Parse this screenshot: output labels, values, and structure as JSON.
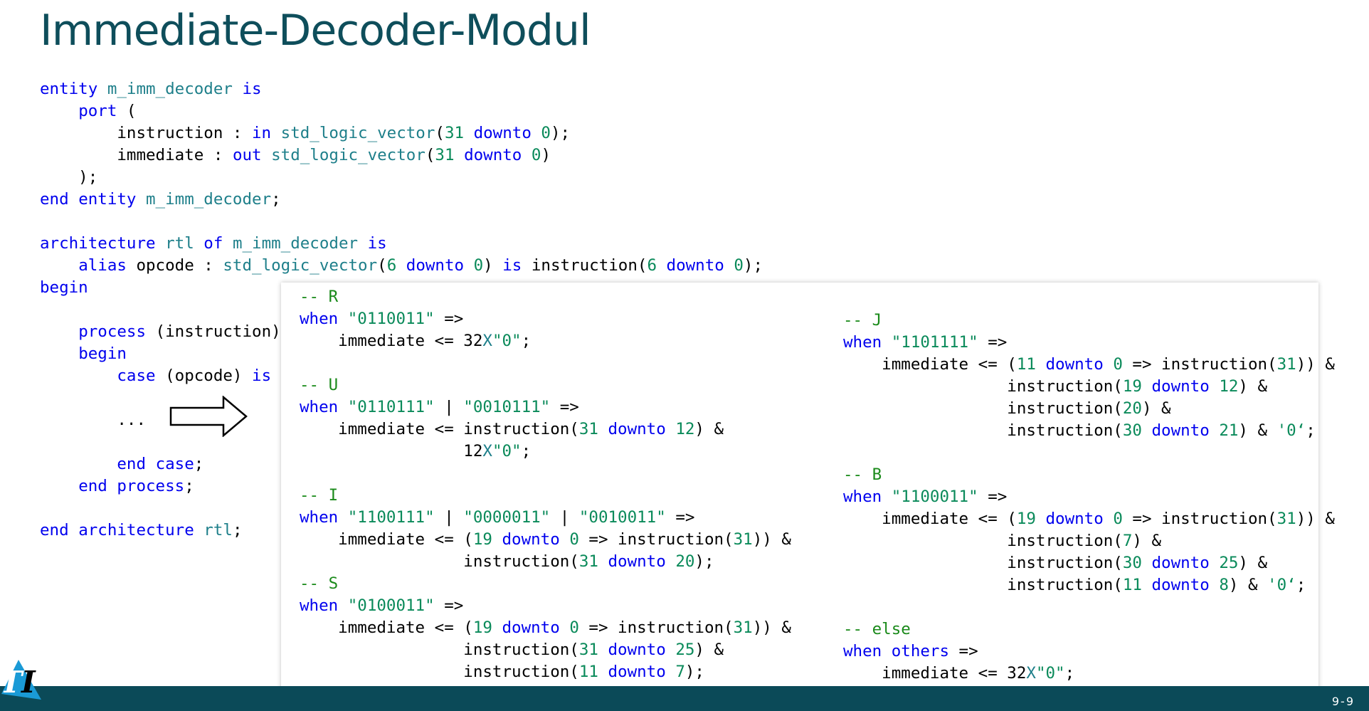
{
  "title": "Immediate-Decoder-Modul",
  "page_number": "9-9",
  "logo_text": "TI",
  "colors": {
    "accent": "#0b4a58",
    "keyword": "#0000ee",
    "type": "#1e7f8a",
    "number": "#0a8a5a",
    "comment": "#1a8a1a"
  },
  "main_code": [
    [
      [
        "kw",
        "entity"
      ],
      [
        "tx",
        " "
      ],
      [
        "ty",
        "m_imm_decoder"
      ],
      [
        "tx",
        " "
      ],
      [
        "kw",
        "is"
      ]
    ],
    [
      [
        "tx",
        "    "
      ],
      [
        "kw",
        "port"
      ],
      [
        "tx",
        " ("
      ]
    ],
    [
      [
        "tx",
        "        instruction : "
      ],
      [
        "kw",
        "in"
      ],
      [
        "tx",
        " "
      ],
      [
        "ty",
        "std_logic_vector"
      ],
      [
        "tx",
        "("
      ],
      [
        "nm",
        "31"
      ],
      [
        "tx",
        " "
      ],
      [
        "kw",
        "downto"
      ],
      [
        "tx",
        " "
      ],
      [
        "nm",
        "0"
      ],
      [
        "tx",
        ");"
      ]
    ],
    [
      [
        "tx",
        "        immediate : "
      ],
      [
        "kw",
        "out"
      ],
      [
        "tx",
        " "
      ],
      [
        "ty",
        "std_logic_vector"
      ],
      [
        "tx",
        "("
      ],
      [
        "nm",
        "31"
      ],
      [
        "tx",
        " "
      ],
      [
        "kw",
        "downto"
      ],
      [
        "tx",
        " "
      ],
      [
        "nm",
        "0"
      ],
      [
        "tx",
        ")"
      ]
    ],
    [
      [
        "tx",
        "    );"
      ]
    ],
    [
      [
        "kw",
        "end"
      ],
      [
        "tx",
        " "
      ],
      [
        "kw",
        "entity"
      ],
      [
        "tx",
        " "
      ],
      [
        "ty",
        "m_imm_decoder"
      ],
      [
        "tx",
        ";"
      ]
    ],
    [
      [
        "tx",
        ""
      ]
    ],
    [
      [
        "kw",
        "architecture"
      ],
      [
        "tx",
        " "
      ],
      [
        "ty",
        "rtl"
      ],
      [
        "tx",
        " "
      ],
      [
        "kw",
        "of"
      ],
      [
        "tx",
        " "
      ],
      [
        "ty",
        "m_imm_decoder"
      ],
      [
        "tx",
        " "
      ],
      [
        "kw",
        "is"
      ]
    ],
    [
      [
        "tx",
        "    "
      ],
      [
        "kw",
        "alias"
      ],
      [
        "tx",
        " opcode : "
      ],
      [
        "ty",
        "std_logic_vector"
      ],
      [
        "tx",
        "("
      ],
      [
        "nm",
        "6"
      ],
      [
        "tx",
        " "
      ],
      [
        "kw",
        "downto"
      ],
      [
        "tx",
        " "
      ],
      [
        "nm",
        "0"
      ],
      [
        "tx",
        ") "
      ],
      [
        "kw",
        "is"
      ],
      [
        "tx",
        " instruction("
      ],
      [
        "nm",
        "6"
      ],
      [
        "tx",
        " "
      ],
      [
        "kw",
        "downto"
      ],
      [
        "tx",
        " "
      ],
      [
        "nm",
        "0"
      ],
      [
        "tx",
        ");"
      ]
    ],
    [
      [
        "kw",
        "begin"
      ]
    ],
    [
      [
        "tx",
        ""
      ]
    ],
    [
      [
        "tx",
        "    "
      ],
      [
        "kw",
        "process"
      ],
      [
        "tx",
        " (instruction)"
      ]
    ],
    [
      [
        "tx",
        "    "
      ],
      [
        "kw",
        "begin"
      ]
    ],
    [
      [
        "tx",
        "        "
      ],
      [
        "kw",
        "case"
      ],
      [
        "tx",
        " (opcode) "
      ],
      [
        "kw",
        "is"
      ]
    ],
    [
      [
        "tx",
        ""
      ]
    ],
    [
      [
        "tx",
        "        ..."
      ]
    ],
    [
      [
        "tx",
        ""
      ]
    ],
    [
      [
        "tx",
        "        "
      ],
      [
        "kw",
        "end"
      ],
      [
        "tx",
        " "
      ],
      [
        "kw",
        "case"
      ],
      [
        "tx",
        ";"
      ]
    ],
    [
      [
        "tx",
        "    "
      ],
      [
        "kw",
        "end"
      ],
      [
        "tx",
        " "
      ],
      [
        "kw",
        "process"
      ],
      [
        "tx",
        ";"
      ]
    ],
    [
      [
        "tx",
        ""
      ]
    ],
    [
      [
        "kw",
        "end"
      ],
      [
        "tx",
        " "
      ],
      [
        "kw",
        "architecture"
      ],
      [
        "tx",
        " "
      ],
      [
        "ty",
        "rtl"
      ],
      [
        "tx",
        ";"
      ]
    ]
  ],
  "popup_left_code": [
    [
      [
        "cm",
        "-- R"
      ]
    ],
    [
      [
        "kw",
        "when"
      ],
      [
        "tx",
        " "
      ],
      [
        "st",
        "\"0110011\""
      ],
      [
        "tx",
        " =>"
      ]
    ],
    [
      [
        "tx",
        "    immediate <= 32"
      ],
      [
        "ty",
        "X"
      ],
      [
        "st",
        "\"0\""
      ],
      [
        "tx",
        ";"
      ]
    ],
    [
      [
        "tx",
        ""
      ]
    ],
    [
      [
        "cm",
        "-- U"
      ]
    ],
    [
      [
        "kw",
        "when"
      ],
      [
        "tx",
        " "
      ],
      [
        "st",
        "\"0110111\""
      ],
      [
        "tx",
        " | "
      ],
      [
        "st",
        "\"0010111\""
      ],
      [
        "tx",
        " =>"
      ]
    ],
    [
      [
        "tx",
        "    immediate <= instruction("
      ],
      [
        "nm",
        "31"
      ],
      [
        "tx",
        " "
      ],
      [
        "kw",
        "downto"
      ],
      [
        "tx",
        " "
      ],
      [
        "nm",
        "12"
      ],
      [
        "tx",
        ") &"
      ]
    ],
    [
      [
        "tx",
        "                 12"
      ],
      [
        "ty",
        "X"
      ],
      [
        "st",
        "\"0\""
      ],
      [
        "tx",
        ";"
      ]
    ],
    [
      [
        "tx",
        ""
      ]
    ],
    [
      [
        "cm",
        "-- I"
      ]
    ],
    [
      [
        "kw",
        "when"
      ],
      [
        "tx",
        " "
      ],
      [
        "st",
        "\"1100111\""
      ],
      [
        "tx",
        " | "
      ],
      [
        "st",
        "\"0000011\""
      ],
      [
        "tx",
        " | "
      ],
      [
        "st",
        "\"0010011\""
      ],
      [
        "tx",
        " =>"
      ]
    ],
    [
      [
        "tx",
        "    immediate <= ("
      ],
      [
        "nm",
        "19"
      ],
      [
        "tx",
        " "
      ],
      [
        "kw",
        "downto"
      ],
      [
        "tx",
        " "
      ],
      [
        "nm",
        "0"
      ],
      [
        "tx",
        " => instruction("
      ],
      [
        "nm",
        "31"
      ],
      [
        "tx",
        ")) &"
      ]
    ],
    [
      [
        "tx",
        "                 instruction("
      ],
      [
        "nm",
        "31"
      ],
      [
        "tx",
        " "
      ],
      [
        "kw",
        "downto"
      ],
      [
        "tx",
        " "
      ],
      [
        "nm",
        "20"
      ],
      [
        "tx",
        ");"
      ]
    ],
    [
      [
        "cm",
        "-- S"
      ]
    ],
    [
      [
        "kw",
        "when"
      ],
      [
        "tx",
        " "
      ],
      [
        "st",
        "\"0100011\""
      ],
      [
        "tx",
        " =>"
      ]
    ],
    [
      [
        "tx",
        "    immediate <= ("
      ],
      [
        "nm",
        "19"
      ],
      [
        "tx",
        " "
      ],
      [
        "kw",
        "downto"
      ],
      [
        "tx",
        " "
      ],
      [
        "nm",
        "0"
      ],
      [
        "tx",
        " => instruction("
      ],
      [
        "nm",
        "31"
      ],
      [
        "tx",
        ")) &"
      ]
    ],
    [
      [
        "tx",
        "                 instruction("
      ],
      [
        "nm",
        "31"
      ],
      [
        "tx",
        " "
      ],
      [
        "kw",
        "downto"
      ],
      [
        "tx",
        " "
      ],
      [
        "nm",
        "25"
      ],
      [
        "tx",
        ") &"
      ]
    ],
    [
      [
        "tx",
        "                 instruction("
      ],
      [
        "nm",
        "11"
      ],
      [
        "tx",
        " "
      ],
      [
        "kw",
        "downto"
      ],
      [
        "tx",
        " "
      ],
      [
        "nm",
        "7"
      ],
      [
        "tx",
        ");"
      ]
    ]
  ],
  "popup_right_code": [
    [
      [
        "cm",
        "-- J"
      ]
    ],
    [
      [
        "kw",
        "when"
      ],
      [
        "tx",
        " "
      ],
      [
        "st",
        "\"1101111\""
      ],
      [
        "tx",
        " =>"
      ]
    ],
    [
      [
        "tx",
        "    immediate <= ("
      ],
      [
        "nm",
        "11"
      ],
      [
        "tx",
        " "
      ],
      [
        "kw",
        "downto"
      ],
      [
        "tx",
        " "
      ],
      [
        "nm",
        "0"
      ],
      [
        "tx",
        " => instruction("
      ],
      [
        "nm",
        "31"
      ],
      [
        "tx",
        ")) &"
      ]
    ],
    [
      [
        "tx",
        "                 instruction("
      ],
      [
        "nm",
        "19"
      ],
      [
        "tx",
        " "
      ],
      [
        "kw",
        "downto"
      ],
      [
        "tx",
        " "
      ],
      [
        "nm",
        "12"
      ],
      [
        "tx",
        ") &"
      ]
    ],
    [
      [
        "tx",
        "                 instruction("
      ],
      [
        "nm",
        "20"
      ],
      [
        "tx",
        ") &"
      ]
    ],
    [
      [
        "tx",
        "                 instruction("
      ],
      [
        "nm",
        "30"
      ],
      [
        "tx",
        " "
      ],
      [
        "kw",
        "downto"
      ],
      [
        "tx",
        " "
      ],
      [
        "nm",
        "21"
      ],
      [
        "tx",
        ") & "
      ],
      [
        "st",
        "'0‘"
      ],
      [
        "tx",
        ";"
      ]
    ],
    [
      [
        "tx",
        ""
      ]
    ],
    [
      [
        "cm",
        "-- B"
      ]
    ],
    [
      [
        "kw",
        "when"
      ],
      [
        "tx",
        " "
      ],
      [
        "st",
        "\"1100011\""
      ],
      [
        "tx",
        " =>"
      ]
    ],
    [
      [
        "tx",
        "    immediate <= ("
      ],
      [
        "nm",
        "19"
      ],
      [
        "tx",
        " "
      ],
      [
        "kw",
        "downto"
      ],
      [
        "tx",
        " "
      ],
      [
        "nm",
        "0"
      ],
      [
        "tx",
        " => instruction("
      ],
      [
        "nm",
        "31"
      ],
      [
        "tx",
        ")) &"
      ]
    ],
    [
      [
        "tx",
        "                 instruction("
      ],
      [
        "nm",
        "7"
      ],
      [
        "tx",
        ") &"
      ]
    ],
    [
      [
        "tx",
        "                 instruction("
      ],
      [
        "nm",
        "30"
      ],
      [
        "tx",
        " "
      ],
      [
        "kw",
        "downto"
      ],
      [
        "tx",
        " "
      ],
      [
        "nm",
        "25"
      ],
      [
        "tx",
        ") &"
      ]
    ],
    [
      [
        "tx",
        "                 instruction("
      ],
      [
        "nm",
        "11"
      ],
      [
        "tx",
        " "
      ],
      [
        "kw",
        "downto"
      ],
      [
        "tx",
        " "
      ],
      [
        "nm",
        "8"
      ],
      [
        "tx",
        ") & "
      ],
      [
        "st",
        "'0‘"
      ],
      [
        "tx",
        ";"
      ]
    ],
    [
      [
        "tx",
        ""
      ]
    ],
    [
      [
        "cm",
        "-- else"
      ]
    ],
    [
      [
        "kw",
        "when"
      ],
      [
        "tx",
        " "
      ],
      [
        "kw",
        "others"
      ],
      [
        "tx",
        " =>"
      ]
    ],
    [
      [
        "tx",
        "    immediate <= 32"
      ],
      [
        "ty",
        "X"
      ],
      [
        "st",
        "\"0\""
      ],
      [
        "tx",
        ";"
      ]
    ]
  ]
}
